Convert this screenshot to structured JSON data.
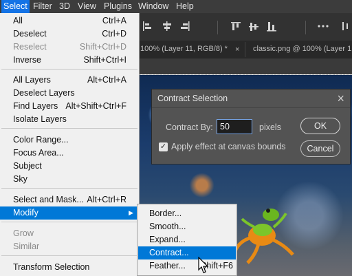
{
  "menubar": {
    "items": [
      "Select",
      "Filter",
      "3D",
      "View",
      "Plugins",
      "Window",
      "Help"
    ],
    "active": "Select"
  },
  "doc_tabs": [
    {
      "title": "100% (Layer 11, RGB/8) *",
      "close": "×"
    },
    {
      "title": "classic.png @ 100% (Layer 1"
    }
  ],
  "select_menu": {
    "groups": [
      [
        {
          "label": "All",
          "shortcut": "Ctrl+A"
        },
        {
          "label": "Deselect",
          "shortcut": "Ctrl+D"
        },
        {
          "label": "Reselect",
          "shortcut": "Shift+Ctrl+D",
          "disabled": true
        },
        {
          "label": "Inverse",
          "shortcut": "Shift+Ctrl+I"
        }
      ],
      [
        {
          "label": "All Layers",
          "shortcut": "Alt+Ctrl+A"
        },
        {
          "label": "Deselect Layers",
          "shortcut": ""
        },
        {
          "label": "Find Layers",
          "shortcut": "Alt+Shift+Ctrl+F"
        },
        {
          "label": "Isolate Layers",
          "shortcut": ""
        }
      ],
      [
        {
          "label": "Color Range...",
          "shortcut": ""
        },
        {
          "label": "Focus Area...",
          "shortcut": ""
        },
        {
          "label": "Subject",
          "shortcut": ""
        },
        {
          "label": "Sky",
          "shortcut": ""
        }
      ],
      [
        {
          "label": "Select and Mask...",
          "shortcut": "Alt+Ctrl+R"
        },
        {
          "label": "Modify",
          "shortcut": "",
          "submenu": true,
          "highlighted": true
        }
      ],
      [
        {
          "label": "Grow",
          "shortcut": "",
          "disabled": true
        },
        {
          "label": "Similar",
          "shortcut": "",
          "disabled": true
        }
      ],
      [
        {
          "label": "Transform Selection",
          "shortcut": ""
        }
      ]
    ]
  },
  "modify_submenu": [
    {
      "label": "Border...",
      "shortcut": ""
    },
    {
      "label": "Smooth...",
      "shortcut": ""
    },
    {
      "label": "Expand...",
      "shortcut": ""
    },
    {
      "label": "Contract...",
      "shortcut": "",
      "highlighted": true
    },
    {
      "label": "Feather...",
      "shortcut": "Shift+F6"
    }
  ],
  "dialog": {
    "title": "Contract Selection",
    "close": "×",
    "field_label": "Contract By:",
    "field_value": "50",
    "unit": "pixels",
    "checkbox_label": "Apply effect at canvas bounds",
    "checkbox_checked": true,
    "ok_label": "OK",
    "cancel_label": "Cancel"
  },
  "toolbar": {
    "icons": [
      "align-left-icon",
      "align-center-icon",
      "align-top-icon",
      "align-middle-icon",
      "align-bottom-icon",
      "more-icon",
      "distribute-icon"
    ],
    "more_glyph": "•••"
  },
  "colors": {
    "menu_highlight": "#0078d7",
    "menubar_active": "#1473e6"
  }
}
